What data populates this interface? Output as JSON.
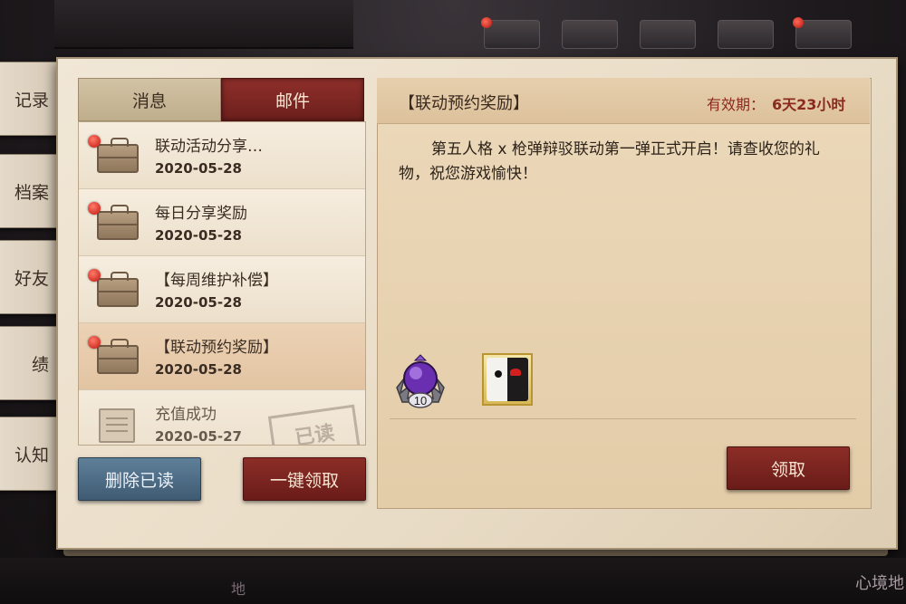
{
  "side_tabs": [
    "记录",
    "档案",
    "好友",
    "绩",
    "认知"
  ],
  "tabs": {
    "messages": "消息",
    "mail": "邮件"
  },
  "mail_list": [
    {
      "title": "联动活动分享…",
      "date": "2020-05-28",
      "unread": true,
      "selected": false
    },
    {
      "title": "每日分享奖励",
      "date": "2020-05-28",
      "unread": true,
      "selected": false
    },
    {
      "title": "【每周维护补偿】",
      "date": "2020-05-28",
      "unread": true,
      "selected": false
    },
    {
      "title": "【联动预约奖励】",
      "date": "2020-05-28",
      "unread": true,
      "selected": true
    },
    {
      "title": "充值成功",
      "date": "2020-05-27",
      "unread": false,
      "selected": false
    }
  ],
  "read_stamp": "已读",
  "buttons": {
    "delete_read": "删除已读",
    "claim_all": "一键领取",
    "claim": "领取"
  },
  "detail": {
    "title": "【联动预约奖励】",
    "validity_label": "有效期：",
    "validity_value": "6天23小时",
    "body": "第五人格 x 枪弹辩驳联动第一弹正式开启！请查收您的礼物，祝您游戏愉快！",
    "rewards": [
      {
        "icon": "purple-orb-icon",
        "count": "10"
      },
      {
        "icon": "monokuma-card-icon",
        "count": ""
      }
    ]
  },
  "bottom": {
    "left_label": "地",
    "right_label": "心境地"
  },
  "colors": {
    "accent_red": "#7d2622",
    "delete_blue": "#4f6d86",
    "paper": "#efe4d2",
    "validity_red": "#8a2a1d"
  }
}
